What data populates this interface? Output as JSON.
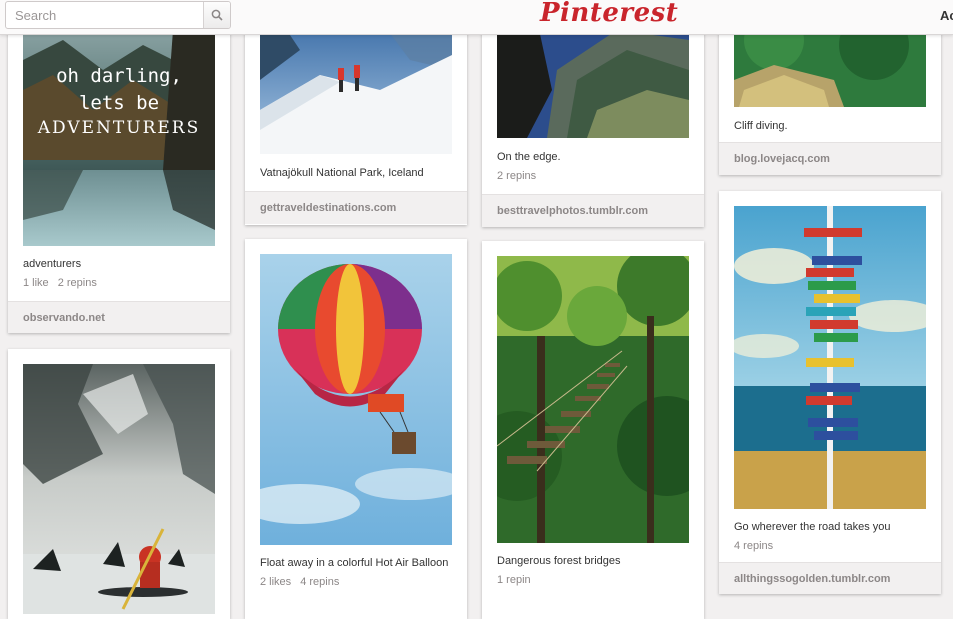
{
  "header": {
    "search_placeholder": "Search",
    "logo_text": "Pinterest",
    "right_text": "Ac"
  },
  "pins": [
    {
      "description": "adventurers",
      "stats": [
        "1 like",
        "2 repins"
      ],
      "source": "observando.net",
      "image_text": [
        "oh darling,",
        "lets be",
        "ADVENTURERS"
      ]
    },
    {
      "description": "",
      "stats": [],
      "source": ""
    },
    {
      "description": "Vatnajökull National Park, Iceland",
      "stats": [],
      "source": "gettraveldestinations.com"
    },
    {
      "description": "Float away in a colorful Hot Air Balloon",
      "stats": [
        "2 likes",
        "4 repins"
      ],
      "source": ""
    },
    {
      "description": "On the edge.",
      "stats": [
        "2 repins"
      ],
      "source": "besttravelphotos.tumblr.com"
    },
    {
      "description": "Dangerous forest bridges",
      "stats": [
        "1 repin"
      ],
      "source": ""
    },
    {
      "description": "Cliff diving.",
      "stats": [],
      "source": "blog.lovejacq.com"
    },
    {
      "description": "Go wherever the road takes you",
      "stats": [
        "4 repins"
      ],
      "source": "allthingssogolden.tumblr.com"
    }
  ]
}
